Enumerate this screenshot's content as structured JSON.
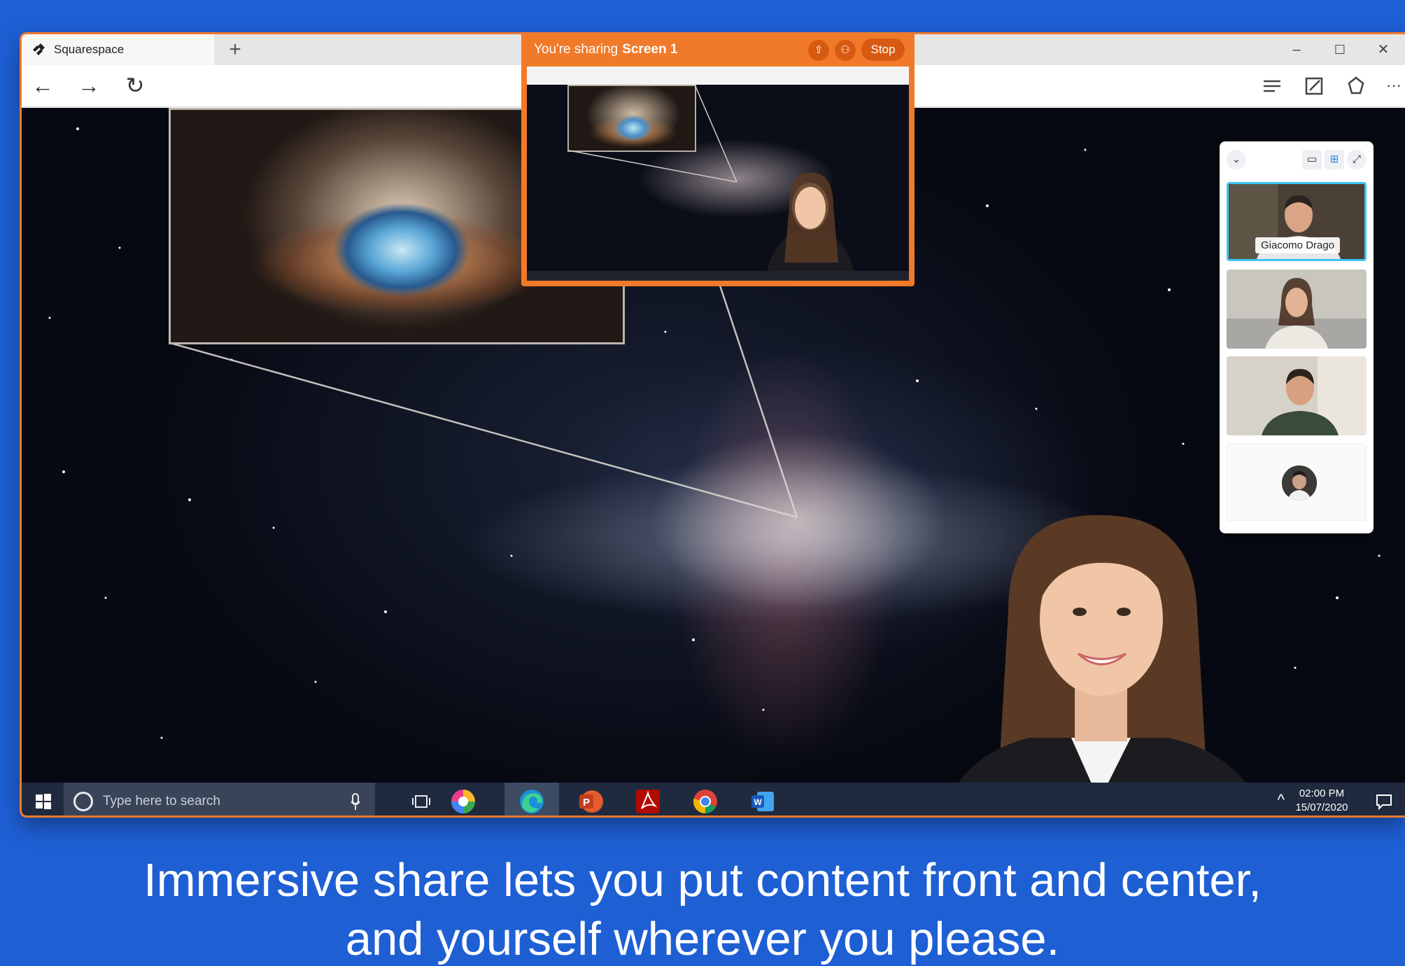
{
  "browser": {
    "tab_title": "Squarespace",
    "new_tab_label": "+",
    "minimize_label": "–",
    "maximize_label": "☐",
    "close_label": "✕",
    "back_label": "←",
    "forward_label": "→",
    "refresh_label": "↻",
    "more_label": "···"
  },
  "share_bar": {
    "prefix": "You're sharing",
    "screen": "Screen 1",
    "stop_label": "Stop"
  },
  "participants": {
    "collapse_label": "⌄",
    "tiles": [
      {
        "name": "Giacomo Drago"
      },
      {
        "name": ""
      },
      {
        "name": ""
      }
    ]
  },
  "taskbar": {
    "search_placeholder": "Type here to search",
    "time": "02:00 PM",
    "date": "15/07/2020",
    "apps": [
      "color-app-icon",
      "edge-icon",
      "powerpoint-icon",
      "acrobat-icon",
      "chrome-icon",
      "word-icon"
    ]
  },
  "caption": {
    "line1": "Immersive share lets you put content front and center,",
    "line2": "and yourself wherever you please."
  },
  "colors": {
    "background": "#1e5fd4",
    "share_accent": "#f07a2a",
    "active_tile": "#3cc4ef",
    "taskbar": "#1f2a3e"
  }
}
